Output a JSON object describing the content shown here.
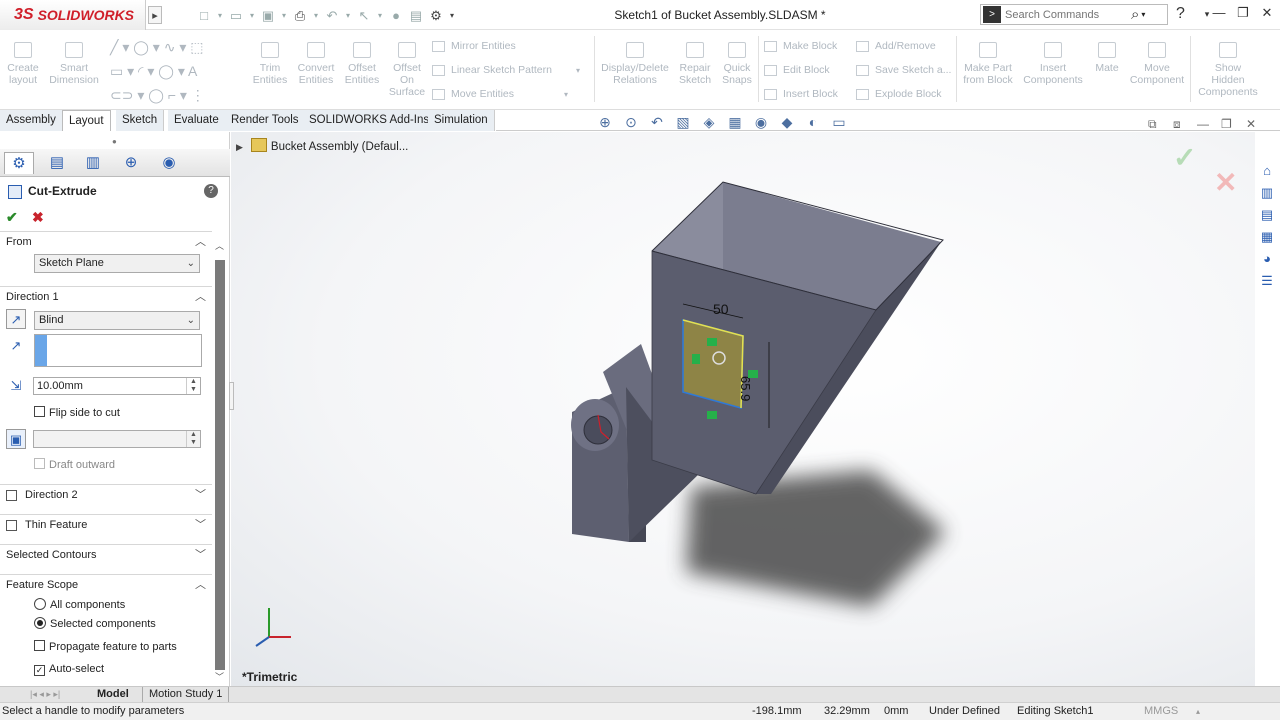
{
  "app": {
    "logo_ds": "3S",
    "logo_name": "SOLIDWORKS",
    "doc_title": "Sketch1 of Bucket Assembly.SLDASM *",
    "search_placeholder": "Search Commands"
  },
  "window_controls": {
    "minimize": "—",
    "restore": "❐",
    "close": "✕",
    "help": "?"
  },
  "ribbon": {
    "big": [
      {
        "label": "Create\nlayout"
      },
      {
        "label": "Smart\nDimension"
      },
      {
        "label": "Trim\nEntities"
      },
      {
        "label": "Convert\nEntities"
      },
      {
        "label": "Offset\nEntities"
      },
      {
        "label": "Offset\nOn\nSurface"
      },
      {
        "label": "Display/Delete\nRelations"
      },
      {
        "label": "Repair\nSketch"
      },
      {
        "label": "Quick\nSnaps"
      },
      {
        "label": "Make Part\nfrom Block"
      },
      {
        "label": "Insert\nComponents"
      },
      {
        "label": "Mate"
      },
      {
        "label": "Move\nComponent"
      },
      {
        "label": "Show\nHidden\nComponents"
      }
    ],
    "small": {
      "mirror": "Mirror Entities",
      "linear": "Linear Sketch Pattern",
      "move": "Move Entities",
      "make_block": "Make Block",
      "edit_block": "Edit Block",
      "insert_block": "Insert Block",
      "add_remove": "Add/Remove",
      "save_sketch": "Save Sketch a...",
      "explode_block": "Explode Block"
    }
  },
  "tabs": [
    "Assembly",
    "Layout",
    "Sketch",
    "Evaluate",
    "Render Tools",
    "SOLIDWORKS Add-Ins",
    "Simulation"
  ],
  "active_tab": "Layout",
  "feature_manager": {
    "title": "Cut-Extrude",
    "from": {
      "header": "From",
      "value": "Sketch Plane"
    },
    "direction1": {
      "header": "Direction 1",
      "type": "Blind",
      "depth": "10.00mm",
      "flip": "Flip side to cut",
      "draft": "Draft outward"
    },
    "direction2": {
      "header": "Direction 2"
    },
    "thin": {
      "header": "Thin Feature"
    },
    "contours": {
      "header": "Selected Contours"
    },
    "scope": {
      "header": "Feature Scope",
      "all": "All components",
      "selected": "Selected components",
      "propagate": "Propagate feature to parts",
      "auto": "Auto-select"
    }
  },
  "tree": {
    "root": "Bucket Assembly  (Defaul..."
  },
  "view": {
    "orientation": "*Trimetric",
    "dim_width": "50",
    "dim_height": "65.9"
  },
  "bottom_tabs": [
    "Model",
    "Motion Study 1"
  ],
  "status": {
    "message": "Select a handle to modify parameters",
    "x": "-198.1mm",
    "y": "32.29mm",
    "z": "0mm",
    "state": "Under Defined",
    "editing": "Editing Sketch1",
    "units": "MMGS"
  }
}
